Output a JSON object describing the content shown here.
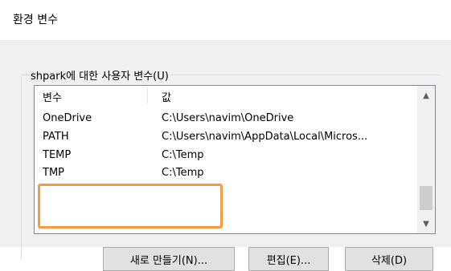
{
  "window": {
    "title": "환경 변수"
  },
  "user_vars": {
    "group_label": "shpark에 대한 사용자 변수(U)",
    "columns": {
      "name": "변수",
      "value": "값"
    },
    "rows": [
      {
        "name": "OneDrive",
        "value": "C:\\Users\\navim\\OneDrive"
      },
      {
        "name": "PATH",
        "value": "C:\\Users\\navim\\AppData\\Local\\Micros..."
      },
      {
        "name": "TEMP",
        "value": "C:\\Temp"
      },
      {
        "name": "TMP",
        "value": "C:\\Temp"
      }
    ],
    "highlighted_rows": [
      "TEMP",
      "TMP"
    ]
  },
  "buttons": {
    "new": "새로 만들기(N)...",
    "edit": "편집(E)...",
    "delete": "삭제(D)"
  },
  "colors": {
    "highlight": "#f59b42",
    "dialog_bg": "#f0f0f0",
    "button_bg": "#e1e1e1"
  },
  "icons": {
    "scroll_up": "chevron-up-icon",
    "scroll_down": "chevron-down-icon"
  }
}
